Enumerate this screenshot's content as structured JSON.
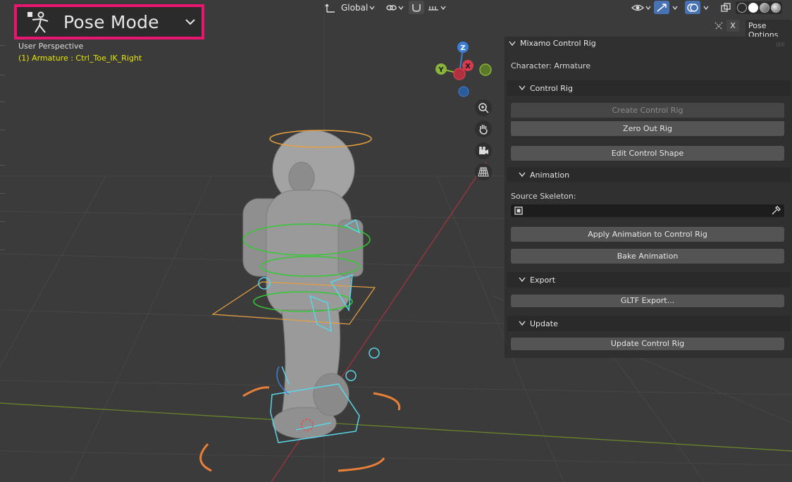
{
  "header": {
    "mode_label": "Pose Mode",
    "transform_orientation": "Global",
    "options_label": "Pose Options",
    "x_label": "X"
  },
  "viewport": {
    "view_name": "User Perspective",
    "active_object": "(1) Armature : Ctrl_Toe_IK_Right"
  },
  "gizmo": {
    "x": "X",
    "y": "Y",
    "z": "Z"
  },
  "panel": {
    "title": "Mixamo Control Rig",
    "character": "Character: Armature",
    "sections": {
      "control_rig": "Control Rig",
      "animation": "Animation",
      "export": "Export",
      "update": "Update"
    },
    "buttons": {
      "create_control_rig": "Create Control Rig",
      "zero_out_rig": "Zero Out Rig",
      "edit_control_shape": "Edit Control Shape",
      "apply_animation": "Apply Animation to Control Rig",
      "bake_animation": "Bake Animation",
      "gltf_export": "GLTF Export...",
      "update_control_rig": "Update Control Rig"
    },
    "source_skeleton_label": "Source Skeleton:",
    "source_skeleton_value": ""
  },
  "colors": {
    "highlight": "#e8166e",
    "axis_x": "#d63c4d",
    "axis_y": "#8ab33a",
    "axis_z": "#3d7fd6",
    "selection_cyan": "#5ad6e8",
    "bone_orange": "#e8a040",
    "bone_green": "#34c934"
  }
}
